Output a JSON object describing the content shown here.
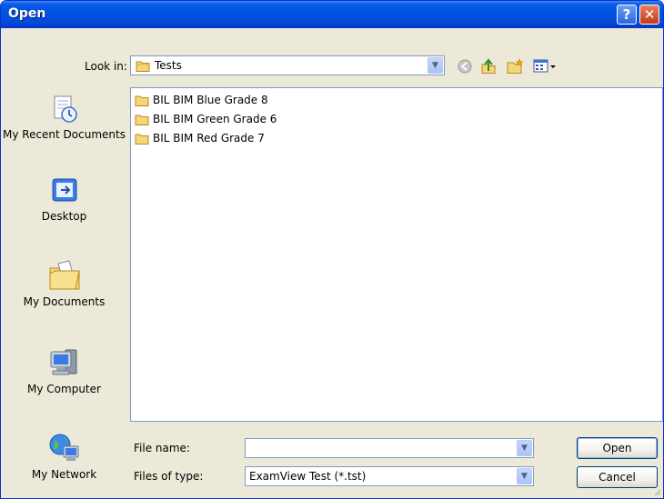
{
  "window": {
    "title": "Open"
  },
  "titlebar": {
    "help_glyph": "?",
    "close_glyph": "✕"
  },
  "lookin": {
    "label": "Look in:",
    "value": "Tests",
    "folder_icon": "folder-icon"
  },
  "toolbar": {
    "icons": [
      "back-icon",
      "up-one-level-icon",
      "create-new-folder-icon",
      "view-menu-icon"
    ]
  },
  "places": [
    {
      "label": "My Recent Documents",
      "icon": "recent-documents-icon"
    },
    {
      "label": "Desktop",
      "icon": "desktop-icon"
    },
    {
      "label": "My Documents",
      "icon": "my-documents-icon"
    },
    {
      "label": "My Computer",
      "icon": "my-computer-icon"
    },
    {
      "label": "My Network",
      "icon": "my-network-icon"
    }
  ],
  "files": [
    {
      "name": "BIL BIM Blue Grade 8",
      "icon": "folder-icon"
    },
    {
      "name": "BIL BIM Green Grade 6",
      "icon": "folder-icon"
    },
    {
      "name": "BIL BIM Red Grade 7",
      "icon": "folder-icon"
    }
  ],
  "filename": {
    "label": "File name:",
    "value": ""
  },
  "filetype": {
    "label": "Files of type:",
    "value": "ExamView Test (*.tst)"
  },
  "buttons": {
    "open": "Open",
    "cancel": "Cancel"
  },
  "colors": {
    "titlebar": "#0054e3",
    "window": "#ece9d8",
    "border": "#7f9db9"
  }
}
